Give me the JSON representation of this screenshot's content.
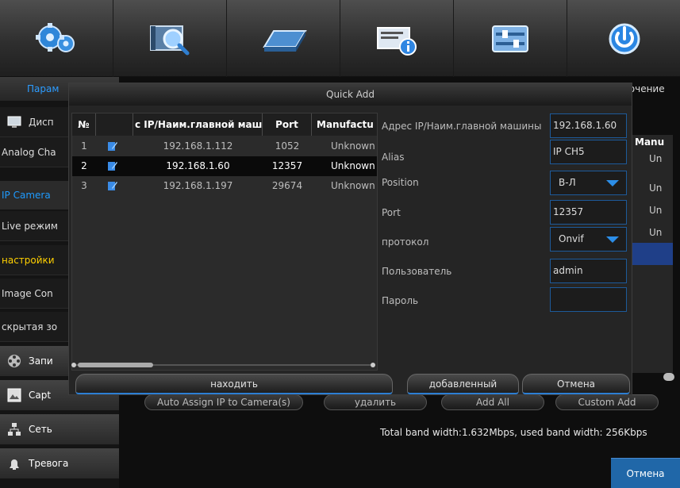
{
  "topbar": {
    "buttons": [
      {
        "name": "settings-gears-icon",
        "color": "#2f86d9"
      },
      {
        "name": "search-film-icon",
        "color": "#6ea6d8"
      },
      {
        "name": "hard-disk-icon",
        "color": "#4d8fd1"
      },
      {
        "name": "system-info-icon",
        "color": "#3b8de0"
      },
      {
        "name": "maintenance-sliders-icon",
        "color": "#7fb2e5"
      },
      {
        "name": "power-icon",
        "color": "#2a86e2"
      }
    ]
  },
  "sidebar": {
    "header_label": "Парам",
    "right_header_label": "ючение",
    "items": [
      {
        "label": "Дисп",
        "icon": "monitor-icon"
      },
      {
        "label": "Analog Cha"
      },
      {
        "label": "IP Camera"
      },
      {
        "label": "Live режим"
      },
      {
        "label": "настройки"
      },
      {
        "label": "Image Con"
      },
      {
        "label": "скрытая зо"
      },
      {
        "label": "Запи",
        "icon": "film-reel-icon"
      },
      {
        "label": "Capt",
        "icon": "capture-icon"
      },
      {
        "label": "Сеть",
        "icon": "network-icon"
      },
      {
        "label": "Тревога",
        "icon": "alarm-icon"
      }
    ]
  },
  "background": {
    "column_header": "Manu",
    "cells": [
      "Un",
      "Un",
      "Un",
      "Un"
    ],
    "buttons": [
      "Auto Assign IP to Camera(s)",
      "удалить",
      "Add All",
      "Custom Add"
    ],
    "bandwidth": "Total band width:1.632Mbps, used band width: 256Kbps",
    "cancel": "Отмена"
  },
  "dialog": {
    "title": "Quick Add",
    "headers": [
      "№",
      "",
      "с IP/Наим.главной маш",
      "Port",
      "Manufactu"
    ],
    "rows": [
      {
        "no": "1",
        "ip": "192.168.1.112",
        "port": "1052",
        "manufacturer": "Unknown"
      },
      {
        "no": "2",
        "ip": "192.168.1.60",
        "port": "12357",
        "manufacturer": "Unknown"
      },
      {
        "no": "3",
        "ip": "192.168.1.197",
        "port": "29674",
        "manufacturer": "Unknown"
      }
    ],
    "selected_row": 2,
    "form": {
      "address_label": "Адрес IP/Наим.главной машины",
      "address_value": "192.168.1.60",
      "alias_label": "Alias",
      "alias_value": "IP CH5",
      "position_label": "Position",
      "position_value": "В-Л",
      "port_label": "Port",
      "port_value": "12357",
      "protocol_label": "протокол",
      "protocol_value": "Onvif",
      "user_label": "Пользователь",
      "user_value": "admin",
      "password_label": "Пароль",
      "password_value": ""
    },
    "buttons": {
      "find": "находить",
      "add": "добавленный",
      "cancel": "Отмена"
    }
  },
  "colors": {
    "accent_blue": "#1e9bff",
    "highlight_yellow": "#ffd000",
    "input_border": "#1d5a9a",
    "edit_icon": "#3a8be6"
  }
}
